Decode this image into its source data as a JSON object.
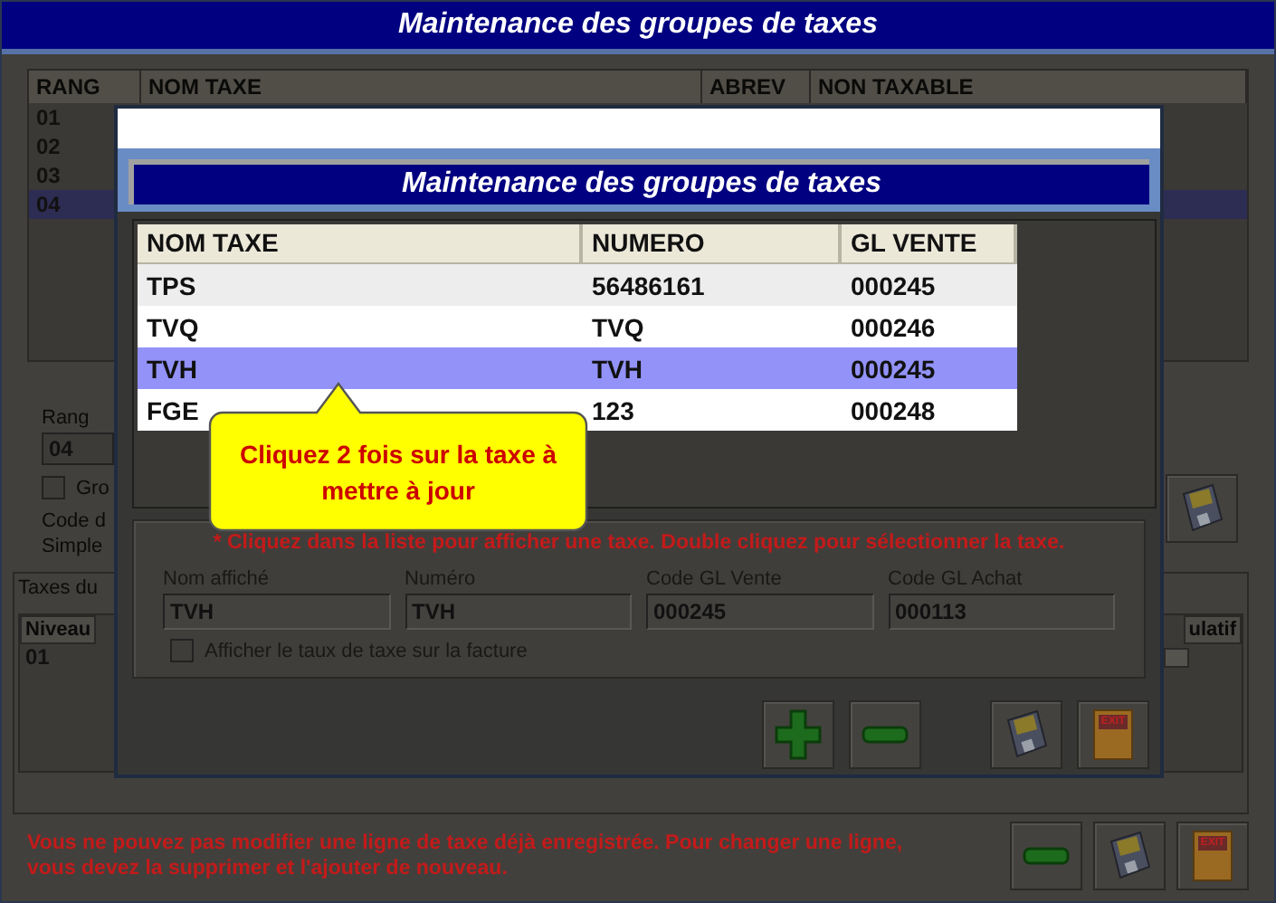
{
  "window": {
    "title": "Maintenance des groupes de taxes"
  },
  "background": {
    "table": {
      "columns": [
        "RANG",
        "NOM TAXE",
        "ABREV",
        "NON TAXABLE"
      ],
      "rows": [
        {
          "rang": "01",
          "selected": false
        },
        {
          "rang": "02",
          "selected": false
        },
        {
          "rang": "03",
          "selected": false
        },
        {
          "rang": "04",
          "selected": true
        }
      ]
    },
    "rang_label": "Rang",
    "rang_value": "04",
    "checkbox": {
      "label": "Gro",
      "checked": false
    },
    "code_text": [
      "Code d",
      "Simple"
    ],
    "side_button": {
      "kind": "save"
    },
    "taxes_group": {
      "label": "Taxes du",
      "columns": [
        "Niveau",
        "ulatif"
      ],
      "rows": [
        {
          "niveau": "01",
          "checked": false
        }
      ]
    },
    "message": "Vous ne pouvez pas modifier une ligne de taxe déjà enregistrée. Pour changer une ligne, vous devez la supprimer et l'ajouter de nouveau.",
    "buttons": [
      {
        "kind": "minus"
      },
      {
        "kind": "save"
      },
      {
        "kind": "exit",
        "label": "EXIT"
      }
    ]
  },
  "modal": {
    "title": "Maintenance des groupes de taxes",
    "table": {
      "columns": [
        "NOM TAXE",
        "NUMERO",
        "GL VENTE"
      ],
      "rows": [
        {
          "cells": [
            "TPS",
            "56486161",
            "000245"
          ],
          "selected": false
        },
        {
          "cells": [
            "TVQ",
            "TVQ",
            "000246"
          ],
          "selected": false
        },
        {
          "cells": [
            "TVH",
            "TVH",
            "000245"
          ],
          "selected": true
        },
        {
          "cells": [
            "FGE",
            "123",
            "000248"
          ],
          "selected": false
        }
      ]
    },
    "hint": "* Cliquez dans la liste pour afficher une taxe. Double cliquez pour sélectionner la taxe.",
    "fields": [
      {
        "label": "Nom affiché",
        "value": "TVH"
      },
      {
        "label": "Numéro",
        "value": "TVH"
      },
      {
        "label": "Code GL Vente",
        "value": "000245"
      },
      {
        "label": "Code GL Achat",
        "value": "000113"
      }
    ],
    "checkbox": {
      "label": "Afficher le taux de taxe sur la facture",
      "checked": false
    },
    "buttons": [
      {
        "kind": "add"
      },
      {
        "kind": "minus"
      },
      {
        "kind": "save"
      },
      {
        "kind": "exit",
        "label": "EXIT"
      }
    ]
  },
  "callout": {
    "text": "Cliquez 2 fois sur la taxe à mettre à jour"
  }
}
